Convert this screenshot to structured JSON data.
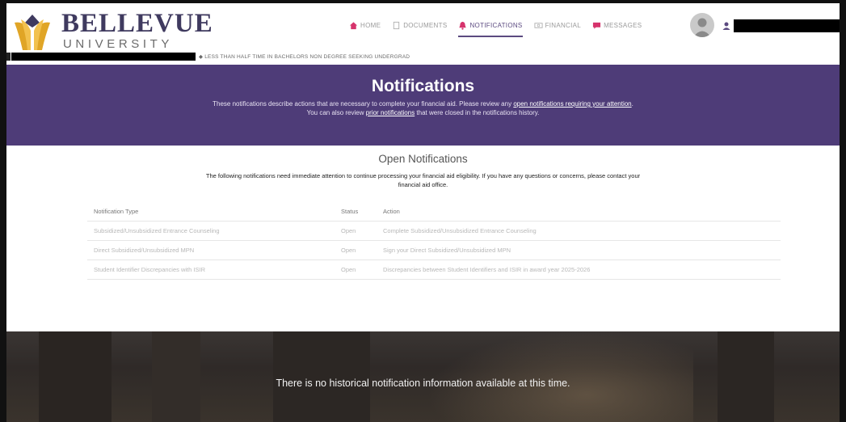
{
  "header": {
    "logo_name": "BELLEVUE",
    "logo_sub": "UNIVERSITY",
    "nav": [
      {
        "label": "HOME",
        "icon": "home-icon",
        "active": false
      },
      {
        "label": "DOCUMENTS",
        "icon": "documents-icon",
        "active": false
      },
      {
        "label": "NOTIFICATIONS",
        "icon": "notifications-icon",
        "active": true
      },
      {
        "label": "FINANCIAL",
        "icon": "financial-icon",
        "active": false
      },
      {
        "label": "MESSAGES",
        "icon": "messages-icon",
        "active": false
      }
    ],
    "enrollment_status": "LESS THAN HALF TIME IN BACHELORS NON DEGREE SEEKING UNDERGRAD"
  },
  "banner": {
    "title": "Notifications",
    "line1_prefix": "These notifications describe actions that are necessary to complete your financial aid. Please review any ",
    "line1_link": "open notifications requiring your attention",
    "line1_suffix": ".",
    "line2_prefix": "You can also review ",
    "line2_link": "prior notifications",
    "line2_suffix": " that were closed in the notifications history."
  },
  "open": {
    "title": "Open Notifications",
    "description": "The following notifications need immediate attention to continue processing your financial aid eligibility. If you have any questions or concerns, please contact your financial aid office.",
    "columns": [
      "Notification Type",
      "Status",
      "Action"
    ],
    "rows": [
      [
        "Subsidized/Unsubsidized Entrance Counseling",
        "Open",
        "Complete Subsidized/Unsubsidized Entrance Counseling"
      ],
      [
        "Direct Subsidized/Unsubsidized MPN",
        "Open",
        "Sign your Direct Subsidized/Unsubsidized MPN"
      ],
      [
        "Student Identifier Discrepancies with ISIR",
        "Open",
        "Discrepancies between Student Identifiers and ISIR in award year 2025-2026"
      ]
    ]
  },
  "history": {
    "message": "There is no historical notification information available at this time."
  },
  "colors": {
    "brand_purple": "#4e3c78",
    "logo_gold": "#e0a526",
    "nav_accent": "#d6336c"
  }
}
